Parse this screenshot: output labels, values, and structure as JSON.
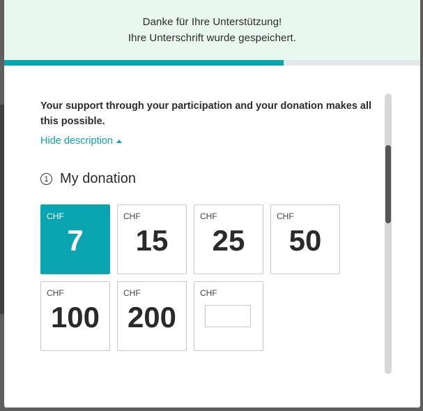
{
  "banner": {
    "line1": "Danke für Ihre Unterstützung!",
    "line2": "Ihre Unterschrift wurde gespeichert."
  },
  "progress": {
    "fraction": 0.672
  },
  "intro_text": "Your support through your participation and your donation makes all this possible.",
  "toggle_label": "Hide description",
  "section": {
    "number": "1",
    "title": "My donation"
  },
  "donation": {
    "currency": "CHF",
    "options": [
      "7",
      "15",
      "25",
      "50",
      "100",
      "200"
    ],
    "selected": "7",
    "custom_value": ""
  },
  "colors": {
    "accent": "#0aa5b0",
    "banner_bg": "#e8f7ef"
  },
  "icons": {
    "toggle": "caret-up-icon"
  }
}
